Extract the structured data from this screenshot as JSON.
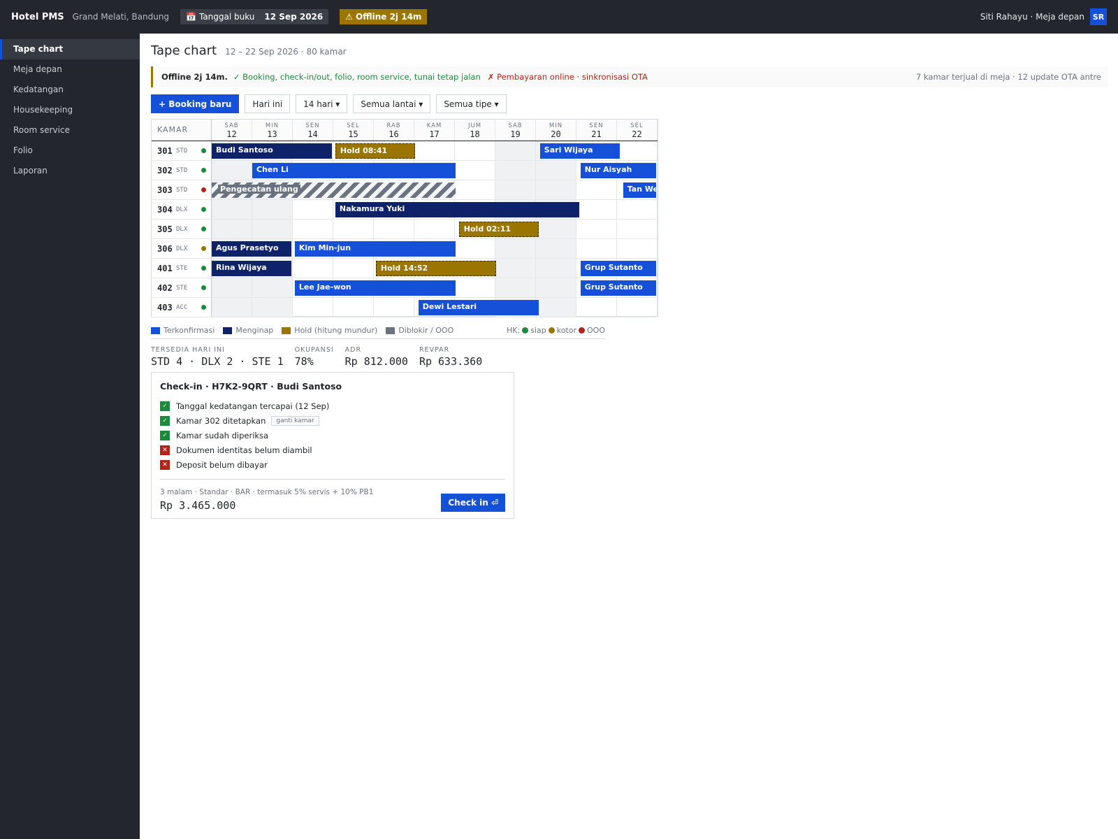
{
  "topbar": {
    "brand": "Hotel PMS",
    "property": "Grand Melati, Bandung",
    "book_date_icon": "calendar-icon",
    "book_date_label": "Tanggal buku",
    "book_date_value": "12 Sep 2026",
    "offline_icon": "warning-icon",
    "offline_label": "Offline 2j 14m",
    "user": "Siti Rahayu · Meja depan",
    "avatar": "SR"
  },
  "sidebar": {
    "items": [
      {
        "label": "Tape chart",
        "active": true
      },
      {
        "label": "Meja depan"
      },
      {
        "label": "Kedatangan"
      },
      {
        "label": "Housekeeping"
      },
      {
        "label": "Room service"
      },
      {
        "label": "Folio"
      },
      {
        "label": "Laporan"
      }
    ]
  },
  "page": {
    "title": "Tape chart",
    "subtitle": "12 – 22 Sep 2026 · 80 kamar"
  },
  "banner": {
    "offline": "Offline 2j 14m.",
    "ok_text": "✓ Booking, check-in/out, folio, room service, tunai tetap jalan",
    "bad_text": "✗ Pembayaran online · sinkronisasi OTA",
    "right_text": "7 kamar terjual di meja · 12 update OTA antre"
  },
  "toolbar": {
    "new_booking": "+ Booking baru",
    "today": "Hari ini",
    "range": "14 hari ▾",
    "floors": "Semua lantai ▾",
    "types": "Semua tipe ▾"
  },
  "tape": {
    "room_header": "KAMAR",
    "days": [
      {
        "dow": "SAB",
        "num": "12",
        "weekend": true
      },
      {
        "dow": "MIN",
        "num": "13",
        "weekend": true
      },
      {
        "dow": "SEN",
        "num": "14"
      },
      {
        "dow": "SEL",
        "num": "15"
      },
      {
        "dow": "RAB",
        "num": "16"
      },
      {
        "dow": "KAM",
        "num": "17"
      },
      {
        "dow": "JUM",
        "num": "18"
      },
      {
        "dow": "SAB",
        "num": "19",
        "weekend": true
      },
      {
        "dow": "MIN",
        "num": "20",
        "weekend": true
      },
      {
        "dow": "SEN",
        "num": "21"
      },
      {
        "dow": "SEL",
        "num": "22"
      }
    ],
    "rooms": [
      {
        "num": "301",
        "type": "STD",
        "hk": "ready"
      },
      {
        "num": "302",
        "type": "STD",
        "hk": "ready"
      },
      {
        "num": "303",
        "type": "STD",
        "hk": "ooo"
      },
      {
        "num": "304",
        "type": "DLX",
        "hk": "ready"
      },
      {
        "num": "305",
        "type": "DLX",
        "hk": "ready"
      },
      {
        "num": "306",
        "type": "DLX",
        "hk": "dirty"
      },
      {
        "num": "401",
        "type": "STE",
        "hk": "ready"
      },
      {
        "num": "402",
        "type": "STE",
        "hk": "ready"
      },
      {
        "num": "403",
        "type": "ACC",
        "hk": "ready"
      }
    ],
    "bookings": [
      {
        "row": 0,
        "start": 0,
        "end": 3.0,
        "status": "inhouse",
        "label": "Budi Santoso"
      },
      {
        "row": 0,
        "start": 3.05,
        "end": 5.05,
        "status": "hold",
        "label": "Hold 08:41"
      },
      {
        "row": 0,
        "start": 8.1,
        "end": 10.1,
        "status": "confirmed",
        "label": "Sari Wijaya"
      },
      {
        "row": 1,
        "start": 1.0,
        "end": 6.05,
        "status": "confirmed",
        "label": "Chen Li"
      },
      {
        "row": 1,
        "start": 9.1,
        "end": 11,
        "status": "confirmed",
        "label": "Nur Aisyah"
      },
      {
        "row": 2,
        "start": 0,
        "end": 6.05,
        "status": "blocked",
        "label": "Pengecatan ulang"
      },
      {
        "row": 2,
        "start": 10.15,
        "end": 11,
        "status": "confirmed",
        "label": "Tan Wei"
      },
      {
        "row": 3,
        "start": 3.05,
        "end": 9.1,
        "status": "inhouse",
        "label": "Nakamura Yuki"
      },
      {
        "row": 4,
        "start": 6.1,
        "end": 8.1,
        "status": "hold",
        "label": "Hold 02:11"
      },
      {
        "row": 5,
        "start": 0,
        "end": 2.0,
        "status": "inhouse",
        "label": "Agus Prasetyo"
      },
      {
        "row": 5,
        "start": 2.05,
        "end": 6.05,
        "status": "confirmed",
        "label": "Kim Min-jun"
      },
      {
        "row": 6,
        "start": 0,
        "end": 2.0,
        "status": "inhouse",
        "label": "Rina Wijaya"
      },
      {
        "row": 6,
        "start": 4.05,
        "end": 7.05,
        "status": "hold",
        "label": "Hold 14:52"
      },
      {
        "row": 6,
        "start": 9.1,
        "end": 11,
        "status": "confirmed",
        "label": "Grup Sutanto"
      },
      {
        "row": 7,
        "start": 2.05,
        "end": 6.05,
        "status": "confirmed",
        "label": "Lee Jae-won"
      },
      {
        "row": 7,
        "start": 9.1,
        "end": 11,
        "status": "confirmed",
        "label": "Grup Sutanto"
      },
      {
        "row": 8,
        "start": 5.1,
        "end": 8.1,
        "status": "confirmed",
        "label": "Dewi Lestari"
      }
    ]
  },
  "legend": {
    "confirmed": "Terkonfirmasi",
    "inhouse": "Menginap",
    "hold": "Hold (hitung mundur)",
    "blocked": "Diblokir / OOO",
    "hk_label": "HK:",
    "hk_ready": "siap",
    "hk_dirty": "kotor",
    "hk_ooo": "OOO"
  },
  "colors": {
    "confirmed": "#1450d8",
    "inhouse": "#0e2269",
    "hold": "#9a7600",
    "blocked": "#6b7280",
    "ready": "#1b8a3a",
    "dirty": "#9a7600",
    "ooo": "#b42318"
  },
  "kpis": [
    {
      "label": "TERSEDIA HARI INI",
      "value": "STD 4 · DLX 2 · STE 1"
    },
    {
      "label": "OKUPANSI",
      "value": "78%"
    },
    {
      "label": "ADR",
      "value": "Rp 812.000"
    },
    {
      "label": "REVPAR",
      "value": "Rp 633.360"
    }
  ],
  "checkin": {
    "title": "Check-in · H7K2-9QRT · Budi Santoso",
    "items": [
      {
        "ok": true,
        "text": "Tanggal kedatangan tercapai (12 Sep)"
      },
      {
        "ok": true,
        "text": "Kamar 302 ditetapkan",
        "action": "ganti kamar"
      },
      {
        "ok": true,
        "text": "Kamar sudah diperiksa"
      },
      {
        "ok": false,
        "text": "Dokumen identitas belum diambil"
      },
      {
        "ok": false,
        "text": "Deposit belum dibayar"
      }
    ],
    "meta": "3 malam · Standar · BAR · termasuk 5% servis + 10% PB1",
    "total": "Rp 3.465.000",
    "button": "Check in ⏎"
  }
}
